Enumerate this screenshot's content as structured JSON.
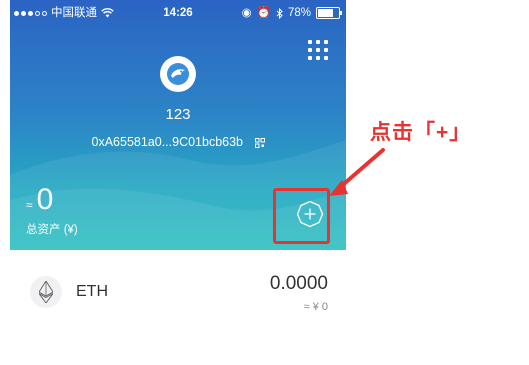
{
  "statusbar": {
    "carrier": "中国联通",
    "time": "14:26",
    "battery": "78%"
  },
  "wallet": {
    "name": "123",
    "address": "0xA65581a0...9C01bcb63b"
  },
  "assets": {
    "approx_symbol": "≈",
    "total": "0",
    "total_label": "总资产 (¥)"
  },
  "tokens": [
    {
      "symbol": "ETH",
      "balance": "0.0000",
      "fiat": "≈ ¥ 0"
    }
  ],
  "annotation": {
    "text": "点击「+」"
  },
  "colors": {
    "accent_red": "#e53432",
    "header_top": "#2b63c4",
    "header_bottom": "#23bdbf"
  },
  "icons": {
    "menu": "grid-menu-icon",
    "avatar": "bird-avatar-icon",
    "qr": "qr-code-icon",
    "add": "add-token-icon",
    "token": "ethereum-icon"
  }
}
